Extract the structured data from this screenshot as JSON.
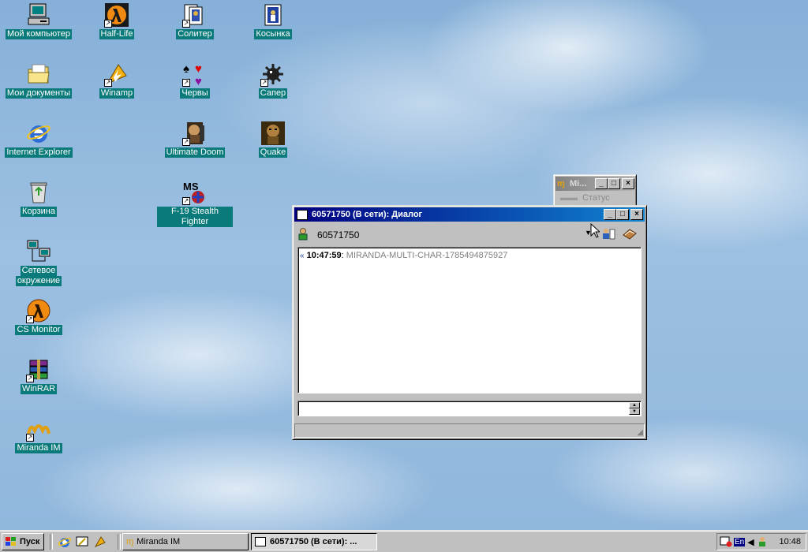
{
  "desktop": {
    "icons": [
      {
        "label": "Мой компьютер",
        "icon": "computer-icon"
      },
      {
        "label": "Half-Life",
        "icon": "half-life-icon"
      },
      {
        "label": "Солитер",
        "icon": "solitaire-icon"
      },
      {
        "label": "Косынка",
        "icon": "spider-solitaire-icon"
      },
      {
        "label": "Мои документы",
        "icon": "folder-icon"
      },
      {
        "label": "Winamp",
        "icon": "winamp-icon"
      },
      {
        "label": "Червы",
        "icon": "hearts-icon"
      },
      {
        "label": "Сапер",
        "icon": "minesweeper-icon"
      },
      {
        "label": "Internet Explorer",
        "icon": "internet-explorer-icon"
      },
      {
        "label": "Ultimate Doom",
        "icon": "doom-icon"
      },
      {
        "label": "Quake",
        "icon": "quake-icon"
      },
      {
        "label": "Корзина",
        "icon": "recycle-bin-icon"
      },
      {
        "label": "F-19 Stealth Fighter",
        "icon": "f19-icon"
      },
      {
        "label": "Сетевое",
        "label2": "окружение",
        "icon": "network-icon"
      },
      {
        "label": "CS Monitor",
        "icon": "cs-monitor-icon"
      },
      {
        "label": "WinRAR",
        "icon": "winrar-icon"
      },
      {
        "label": "Miranda IM",
        "icon": "miranda-icon"
      }
    ],
    "f19_ms": "MS"
  },
  "miranda_main": {
    "title": "Mi...",
    "status": "Статус"
  },
  "dialog": {
    "title": "60571750 (В сети): Диалог",
    "contact": "60571750",
    "message": {
      "time": "10:47:59",
      "separator": ":",
      "text": "MIRANDA-MULTI-CHAR-1785494875927"
    },
    "input_value": ""
  },
  "taskbar": {
    "start_label": "Пуск",
    "tasks": [
      {
        "label": "Miranda IM"
      },
      {
        "label": "60571750 (В сети): ..."
      }
    ],
    "tray": {
      "lang": "En",
      "clock": "10:48"
    }
  },
  "colors": {
    "title_active": "#000080",
    "label_bg": "#0a7a7a",
    "face": "#c0c0c0"
  }
}
